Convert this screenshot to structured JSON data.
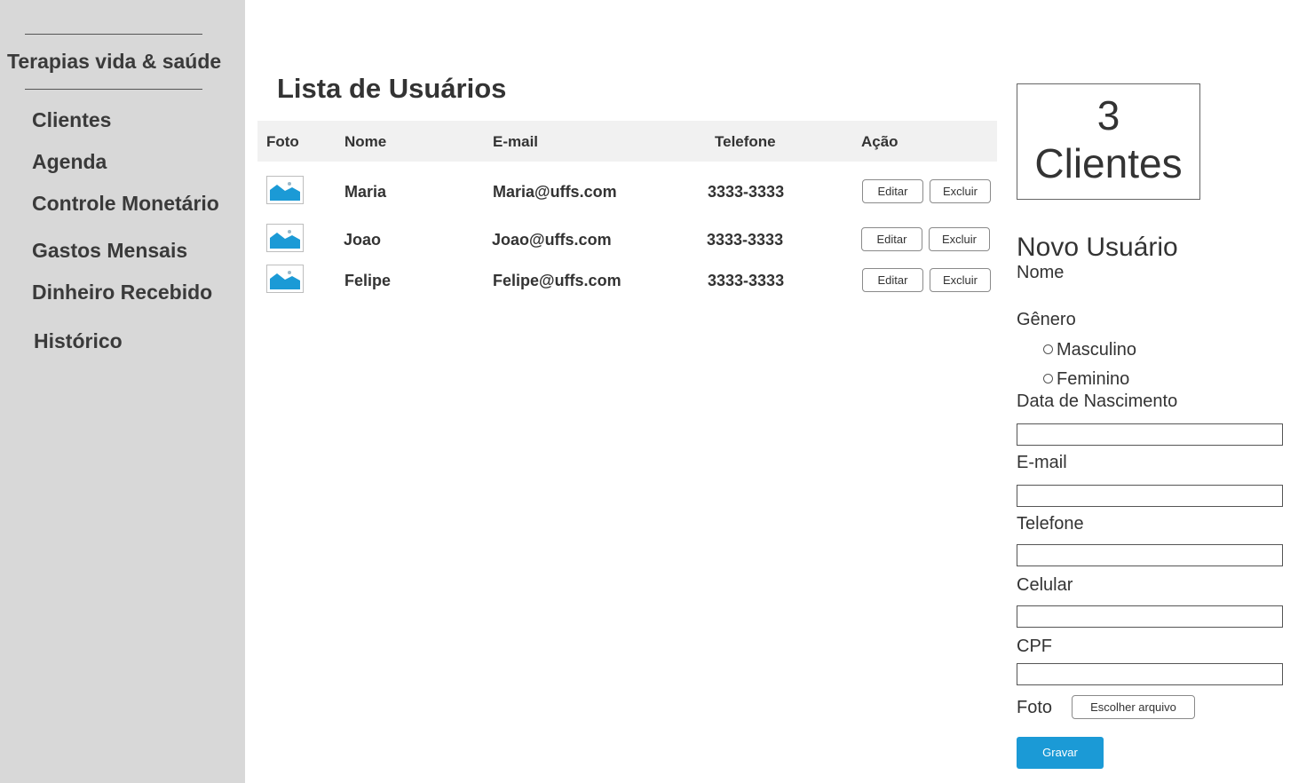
{
  "sidebar": {
    "brand": "Terapias vida & saúde",
    "items": [
      {
        "label": "Clientes"
      },
      {
        "label": "Agenda"
      },
      {
        "label": "Controle Monetário"
      },
      {
        "label": "Gastos Mensais"
      },
      {
        "label": "Dinheiro Recebido"
      },
      {
        "label": "Histórico"
      }
    ]
  },
  "main": {
    "title": "Lista de Usuários",
    "columns": [
      "Foto",
      "Nome",
      "E-mail",
      "Telefone",
      "Ação"
    ],
    "rows": [
      {
        "photo_icon": "image-placeholder-icon",
        "name": "Maria",
        "email": "Maria@uffs.com",
        "phone": "3333-3333",
        "edit": "Editar",
        "delete": "Excluir"
      },
      {
        "photo_icon": "image-placeholder-icon",
        "name": "Joao",
        "email": "Joao@uffs.com",
        "phone": "3333-3333",
        "edit": "Editar",
        "delete": "Excluir"
      },
      {
        "photo_icon": "image-placeholder-icon",
        "name": "Felipe",
        "email": "Felipe@uffs.com",
        "phone": "3333-3333",
        "edit": "Editar",
        "delete": "Excluir"
      }
    ]
  },
  "summary": {
    "count": "3",
    "label": "Clientes"
  },
  "form": {
    "title": "Novo Usuário",
    "nome_label": "Nome",
    "genero_label": "Gênero",
    "genero_options": [
      "Masculino",
      "Feminino"
    ],
    "nascimento_label": "Data de Nascimento",
    "email_label": "E-mail",
    "telefone_label": "Telefone",
    "celular_label": "Celular",
    "cpf_label": "CPF",
    "foto_label": "Foto",
    "file_button": "Escolher arquivo",
    "save_button": "Gravar"
  },
  "colors": {
    "sidebar_bg": "#d8d8d8",
    "header_bg": "#f1f1f1",
    "accent": "#1b9ad6"
  }
}
